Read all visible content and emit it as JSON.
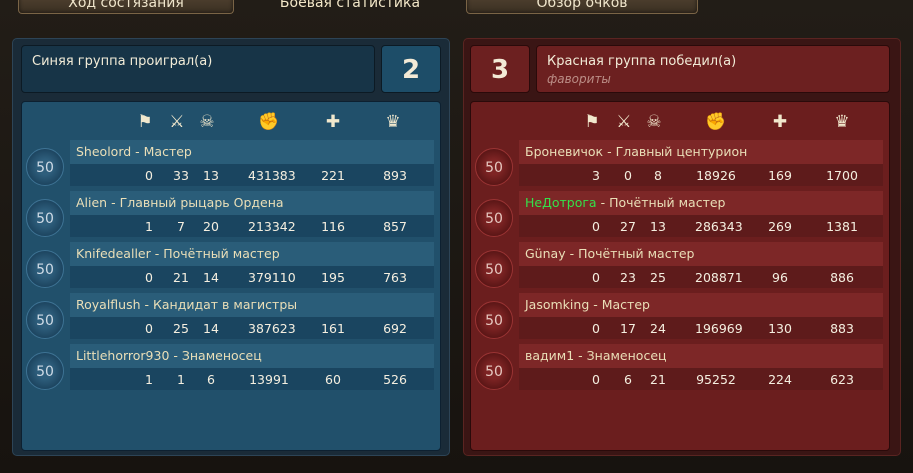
{
  "tabs": [
    {
      "label": "Ход состязания"
    },
    {
      "label": "Боевая статистика"
    },
    {
      "label": "Обзор очков"
    }
  ],
  "column_icons": [
    "flag-icon",
    "crossed-swords-icon",
    "skull-icon",
    "fist-icon",
    "plus-icon",
    "crown-icon"
  ],
  "blue": {
    "team_name": "Синяя группа проиграл(а)",
    "score": "2",
    "color": "#21506b",
    "players": [
      {
        "level": "50",
        "name": "Sheolord",
        "sep": " - ",
        "rank": "Мастер",
        "stats": [
          "0",
          "33",
          "13",
          "431383",
          "221",
          "893"
        ]
      },
      {
        "level": "50",
        "name": "Alien",
        "sep": " - ",
        "rank": "Главный рыцарь Ордена",
        "stats": [
          "1",
          "7",
          "20",
          "213342",
          "116",
          "857"
        ]
      },
      {
        "level": "50",
        "name": "Knifedealler",
        "sep": " - ",
        "rank": "Почётный мастер",
        "stats": [
          "0",
          "21",
          "14",
          "379110",
          "195",
          "763"
        ]
      },
      {
        "level": "50",
        "name": "Royalflush",
        "sep": " - ",
        "rank": "Кандидат в магистры",
        "stats": [
          "0",
          "25",
          "14",
          "387623",
          "161",
          "692"
        ]
      },
      {
        "level": "50",
        "name": "Littlehorror930",
        "sep": " - ",
        "rank": "Знаменосец",
        "stats": [
          "1",
          "1",
          "6",
          "13991",
          "60",
          "526"
        ]
      }
    ]
  },
  "red": {
    "team_name": "Красная группа победил(а)",
    "team_sub": "фавориты",
    "score": "3",
    "color": "#6b1e1e",
    "players": [
      {
        "level": "50",
        "name": "Броневичок",
        "sep": " - ",
        "rank": "Главный центурион",
        "stats": [
          "3",
          "0",
          "8",
          "18926",
          "169",
          "1700"
        ]
      },
      {
        "level": "50",
        "name": "НеДотрога",
        "sep": " - ",
        "rank": "Почётный мастер",
        "stats": [
          "0",
          "27",
          "13",
          "286343",
          "269",
          "1381"
        ],
        "name_color": "#35e04a"
      },
      {
        "level": "50",
        "name": "Günay",
        "sep": " - ",
        "rank": "Почётный мастер",
        "stats": [
          "0",
          "23",
          "25",
          "208871",
          "96",
          "886"
        ]
      },
      {
        "level": "50",
        "name": "Jasomking",
        "sep": " - ",
        "rank": "Мастер",
        "stats": [
          "0",
          "17",
          "24",
          "196969",
          "130",
          "883"
        ]
      },
      {
        "level": "50",
        "name": "вадим1",
        "sep": " - ",
        "rank": "Знаменосец",
        "stats": [
          "0",
          "6",
          "21",
          "95252",
          "224",
          "623"
        ]
      }
    ]
  }
}
